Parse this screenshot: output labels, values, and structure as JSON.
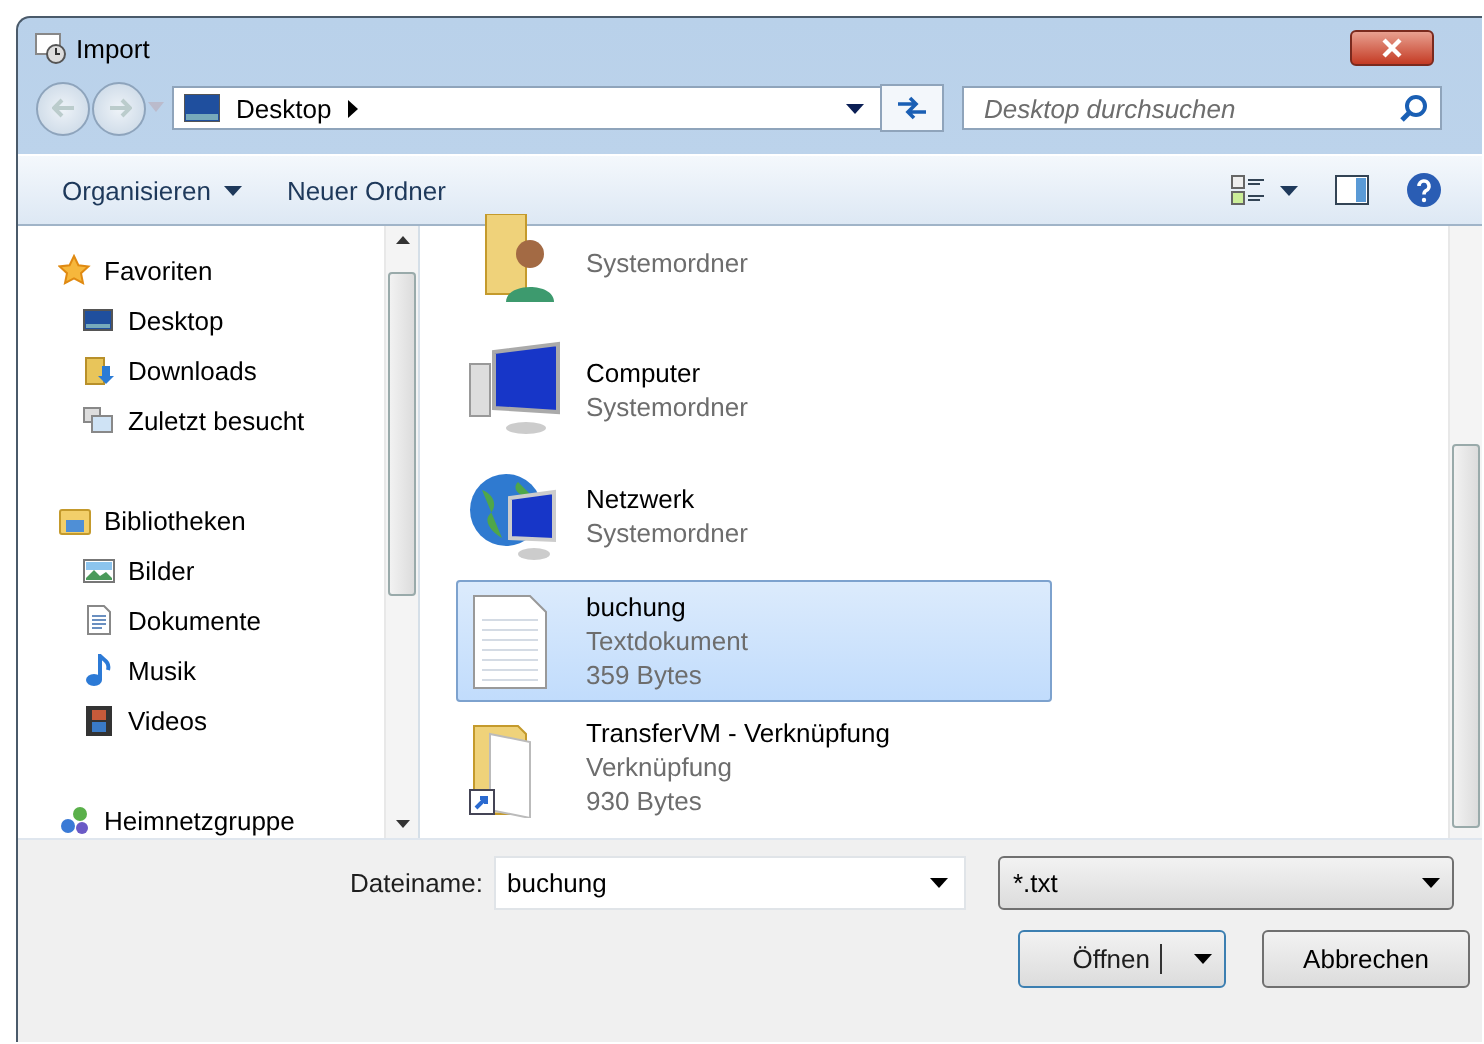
{
  "window": {
    "title": "Import"
  },
  "address": {
    "crumbs": [
      "Desktop"
    ]
  },
  "search": {
    "placeholder": "Desktop durchsuchen"
  },
  "toolbar": {
    "buttons": [
      {
        "label": "Organisieren",
        "dropdown": true
      },
      {
        "label": "Neuer Ordner",
        "dropdown": false
      }
    ]
  },
  "sidebar": {
    "items": [
      {
        "label": "Favoriten",
        "kind": "star",
        "children": [
          {
            "label": "Desktop",
            "kind": "desktop"
          },
          {
            "label": "Downloads",
            "kind": "downloads"
          },
          {
            "label": "Zuletzt besucht",
            "kind": "recent"
          }
        ]
      },
      {
        "label": "Bibliotheken",
        "kind": "library",
        "children": [
          {
            "label": "Bilder",
            "kind": "pictures"
          },
          {
            "label": "Dokumente",
            "kind": "documents"
          },
          {
            "label": "Musik",
            "kind": "music"
          },
          {
            "label": "Videos",
            "kind": "videos"
          }
        ]
      },
      {
        "label": "Heimnetzgruppe",
        "kind": "homegroup"
      }
    ]
  },
  "files": [
    {
      "kind": "user",
      "details": [
        "Systemordner"
      ],
      "selected": false
    },
    {
      "kind": "computer",
      "name": "Computer",
      "details": [
        "Systemordner"
      ],
      "selected": false
    },
    {
      "kind": "network",
      "name": "Netzwerk",
      "details": [
        "Systemordner"
      ],
      "selected": false
    },
    {
      "kind": "text",
      "name": "buchung",
      "details": [
        "Textdokument",
        "359 Bytes"
      ],
      "selected": true
    },
    {
      "kind": "shortcut",
      "name": "TransferVM - Verknüpfung",
      "details": [
        "Verknüpfung",
        "930 Bytes"
      ],
      "selected": false
    }
  ],
  "footer": {
    "filename_label": "Dateiname:",
    "filename": "buchung",
    "filter": "*.txt",
    "buttons": [
      {
        "label": "Öffnen",
        "kind": "split"
      },
      {
        "label": "Abbrechen",
        "kind": "plain"
      }
    ]
  }
}
